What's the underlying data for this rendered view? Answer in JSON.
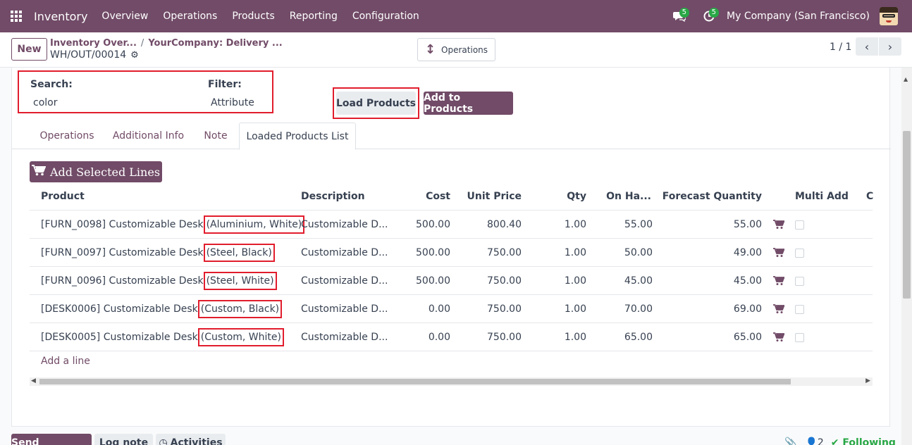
{
  "navbar": {
    "app_name": "Inventory",
    "menu": [
      "Overview",
      "Operations",
      "Products",
      "Reporting",
      "Configuration"
    ],
    "messages_count": "5",
    "activities_count": "5",
    "company": "My Company (San Francisco)"
  },
  "control": {
    "new_label": "New",
    "breadcrumb_1": "Inventory Over...",
    "breadcrumb_2": "YourCompany: Delivery ...",
    "record_name": "WH/OUT/00014",
    "smart_button": "Operations",
    "pager": "1 / 1"
  },
  "form": {
    "search_label": "Search:",
    "search_value": "color",
    "filter_label": "Filter:",
    "filter_value": "Attribute",
    "load_products": "Load Products",
    "add_to_products": "Add to Products",
    "tabs": [
      "Operations",
      "Additional Info",
      "Note",
      "Loaded Products List"
    ],
    "add_selected_lines": "Add Selected Lines",
    "add_a_line": "Add a line"
  },
  "table": {
    "headers": [
      "Product",
      "Description",
      "Cost",
      "Unit Price",
      "Qty",
      "On Ha...",
      "Forecast Quantity",
      "Multi Add",
      "C"
    ],
    "rows": [
      {
        "product": "[FURN_0098] Customizable Desk",
        "variant": "(Aluminium, White)",
        "description": "Customizable D...",
        "cost": "500.00",
        "unit_price": "800.40",
        "qty": "1.00",
        "on_hand": "55.00",
        "forecast": "55.00"
      },
      {
        "product": "[FURN_0097] Customizable Desk",
        "variant": "(Steel, Black)",
        "description": "Customizable D...",
        "cost": "500.00",
        "unit_price": "750.00",
        "qty": "1.00",
        "on_hand": "50.00",
        "forecast": "49.00"
      },
      {
        "product": "[FURN_0096] Customizable Desk",
        "variant": "(Steel, White)",
        "description": "Customizable D...",
        "cost": "500.00",
        "unit_price": "750.00",
        "qty": "1.00",
        "on_hand": "45.00",
        "forecast": "45.00"
      },
      {
        "product": "[DESK0006] Customizable Desk",
        "variant": "(Custom, Black)",
        "description": "Customizable D...",
        "cost": "0.00",
        "unit_price": "750.00",
        "qty": "1.00",
        "on_hand": "70.00",
        "forecast": "69.00"
      },
      {
        "product": "[DESK0005] Customizable Desk",
        "variant": "(Custom, White)",
        "description": "Customizable D...",
        "cost": "0.00",
        "unit_price": "750.00",
        "qty": "1.00",
        "on_hand": "65.00",
        "forecast": "65.00"
      }
    ]
  },
  "chatter": {
    "send_message": "Send message",
    "log_note": "Log note",
    "activities": "Activities",
    "followers_count": "2",
    "following": "Following"
  },
  "colors": {
    "brand": "#714b67",
    "highlight": "#e11d2d",
    "badge": "#28a745"
  }
}
